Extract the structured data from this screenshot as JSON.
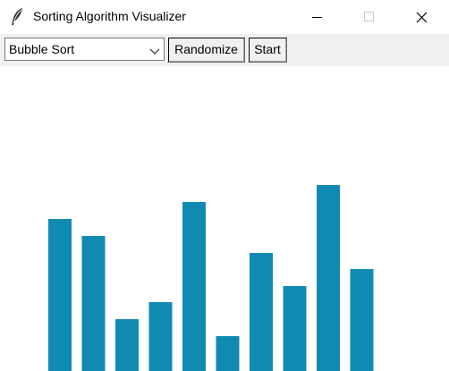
{
  "window": {
    "title": "Sorting Algorithm Visualizer",
    "app_icon": "feather-icon",
    "controls": [
      "minimize-icon",
      "maximize-icon",
      "close-icon"
    ]
  },
  "toolbar": {
    "algorithm_select": {
      "value": "Bubble Sort"
    },
    "randomize_label": "Randomize",
    "start_label": "Start"
  },
  "colors": {
    "bar": "#118ab2",
    "toolbar_bg": "#f0f0f0",
    "canvas_bg": "#ffffff"
  },
  "chart_data": {
    "type": "bar",
    "values": [
      170,
      151,
      58,
      77,
      189,
      39,
      132,
      95,
      208,
      114
    ]
  }
}
